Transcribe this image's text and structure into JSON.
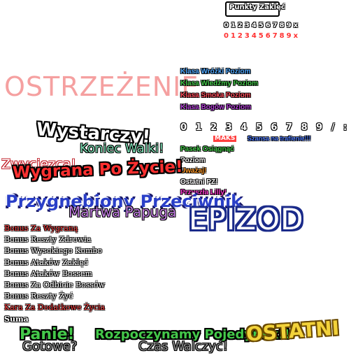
{
  "spell_points": {
    "title": "Punkty Zaklęć",
    "digits_white": "0123456789x",
    "digits_red": "0123456789x"
  },
  "warning": "OSTRZEŻENIE",
  "classes": [
    {
      "label": "Klasa Wróżki  Poziom",
      "color": "#4fa8ff"
    },
    {
      "label": "Klasa Wiedźmy  Poziom",
      "color": "#44c84a"
    },
    {
      "label": "Klasa Smoka  Poziom",
      "color": "#ff4b5a"
    },
    {
      "label": "Klasa Bogów  Poziom",
      "color": "#b23fd6"
    }
  ],
  "digits_row": "0 1 2 3 4 5 6 7 8 9 / :",
  "maks": "MAKS",
  "hit_chance": "Szansa na trafienie!!!",
  "status": {
    "bar": "Pasek Osiągnąć",
    "level": "Poziom",
    "careful": "Uważaj!",
    "last_pz": "Ostatni PZ!",
    "lily": "Przyszła Lilly!"
  },
  "enough": "Wystarczy!",
  "end_fight": "Koniec Walki!",
  "winner": "Zwycięzca!",
  "won_life": "Wygrana Po Życie!",
  "summoned": "Przygnębiony Przeciwnik",
  "dead_parrot": "Martwa Papuga",
  "episode": "EPIZOD",
  "bonuses": [
    {
      "label": "Bonus Za Wygraną",
      "color": "#ff4040"
    },
    {
      "label": "Bonus Reszty Zdrowia",
      "color": "#ffffff"
    },
    {
      "label": "Bonus Wysokiego Kombo",
      "color": "#ffffff"
    },
    {
      "label": "Bonus Ataków Zaklęć",
      "color": "#ffffff"
    },
    {
      "label": "Bonus Ataków Bossem",
      "color": "#ffffff"
    },
    {
      "label": "Bonus Za Odbicie Bossów",
      "color": "#ffffff"
    },
    {
      "label": "Bonus Reszty Żyć",
      "color": "#ffffff"
    },
    {
      "label": "Kara Za Dodatkowe Życia",
      "color": "#ff4040"
    }
  ],
  "sum": "Suma",
  "ready_top": "Panie!",
  "ready": "Gotowe?",
  "start_duel": "Rozpoczynamy Pojedynek!!",
  "fight_time": "Czas Walczyć!",
  "last": "OSTATNI"
}
